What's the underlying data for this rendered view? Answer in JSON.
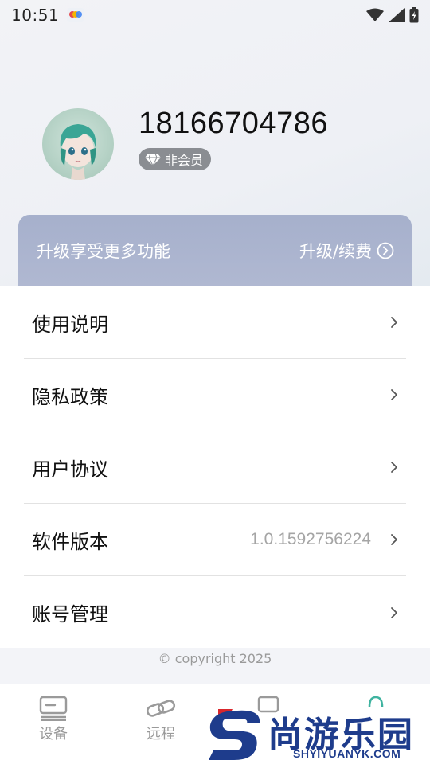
{
  "status_bar": {
    "time": "10:51",
    "icons": [
      "app-notification-icon",
      "wifi-icon",
      "signal-icon",
      "battery-charging-icon"
    ]
  },
  "profile": {
    "phone": "18166704786",
    "member_status": "非会员",
    "member_icon": "diamond-icon"
  },
  "upgrade": {
    "text": "升级享受更多功能",
    "link_label": "升级/续费",
    "link_icon": "circle-chevron-right-icon"
  },
  "menu": {
    "items": [
      {
        "label": "使用说明",
        "value": ""
      },
      {
        "label": "隐私政策",
        "value": ""
      },
      {
        "label": "用户协议",
        "value": ""
      },
      {
        "label": "软件版本",
        "value": "1.0.1592756224"
      },
      {
        "label": "账号管理",
        "value": ""
      }
    ]
  },
  "footer": {
    "copyright": "© copyright 2025"
  },
  "tab_bar": {
    "tabs": [
      {
        "label": "设备",
        "icon": "device-icon"
      },
      {
        "label": "远程",
        "icon": "link-icon"
      },
      {
        "label": "",
        "icon": "cast-icon"
      },
      {
        "label": "",
        "icon": "person-icon"
      }
    ]
  },
  "watermark": {
    "text": "尚游乐园",
    "url": "SHYIYUANYK.COM"
  },
  "colors": {
    "upgrade_card": "#a6b0cc",
    "member_badge": "#8a8d92",
    "watermark_blue": "#1e3c8c",
    "watermark_red": "#d9262c"
  }
}
